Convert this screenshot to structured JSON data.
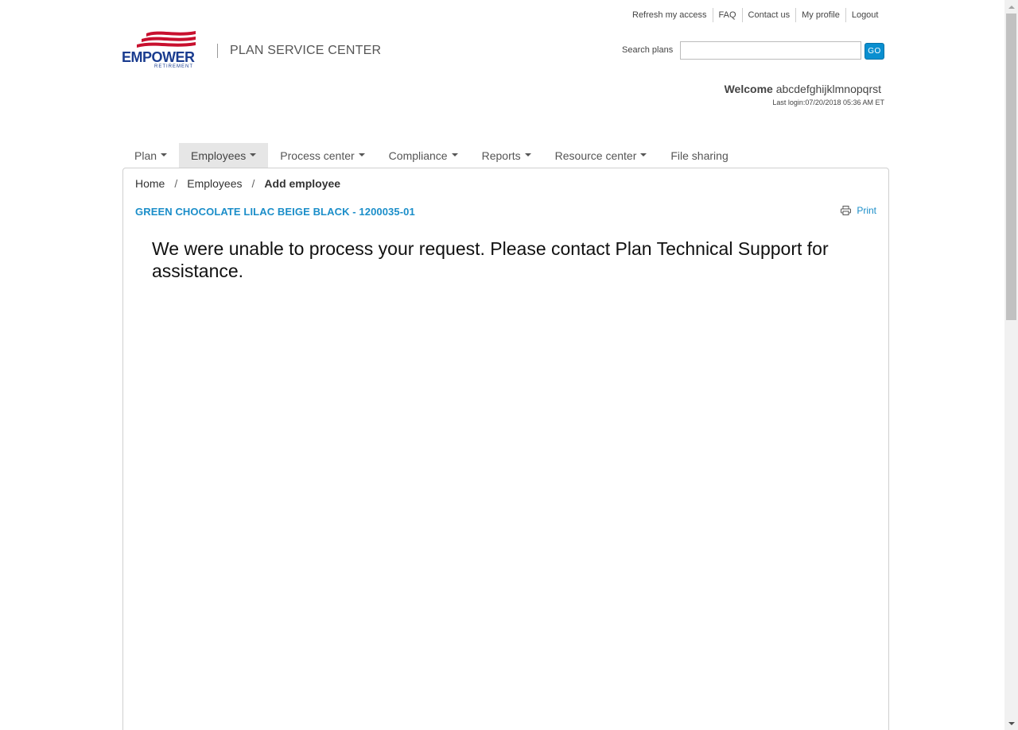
{
  "utility_nav": [
    "Refresh my access",
    "FAQ",
    "Contact us",
    "My profile",
    "Logout"
  ],
  "brand": {
    "wordmark": "EMPOWER",
    "sub": "RETIREMENT",
    "title": "PLAN SERVICE CENTER",
    "logo_colors": {
      "red": "#c8102e",
      "blue": "#1a3c8f"
    }
  },
  "search": {
    "label": "Search plans",
    "value": "",
    "button": "GO"
  },
  "user": {
    "welcome_label": "Welcome",
    "name": "abcdefghijklmnopqrst",
    "last_login": "Last login:07/20/2018 05:36 AM ET"
  },
  "main_nav": [
    {
      "label": "Plan",
      "dropdown": true,
      "active": false
    },
    {
      "label": "Employees",
      "dropdown": true,
      "active": true
    },
    {
      "label": "Process center",
      "dropdown": true,
      "active": false
    },
    {
      "label": "Compliance",
      "dropdown": true,
      "active": false
    },
    {
      "label": "Reports",
      "dropdown": true,
      "active": false
    },
    {
      "label": "Resource center",
      "dropdown": true,
      "active": false
    },
    {
      "label": "File sharing",
      "dropdown": false,
      "active": false
    }
  ],
  "breadcrumb": {
    "items": [
      "Home",
      "Employees"
    ],
    "separator": "/",
    "current": "Add employee"
  },
  "plan_name": "GREEN CHOCOLATE LILAC BEIGE BLACK - 1200035-01",
  "print_label": "Print",
  "error_message": "We were unable to process your request. Please contact Plan Technical Support for assistance.",
  "colors": {
    "accent": "#1b8ec9",
    "go_button": "#0a8fd0",
    "nav_active_bg": "#e6e6e6"
  }
}
